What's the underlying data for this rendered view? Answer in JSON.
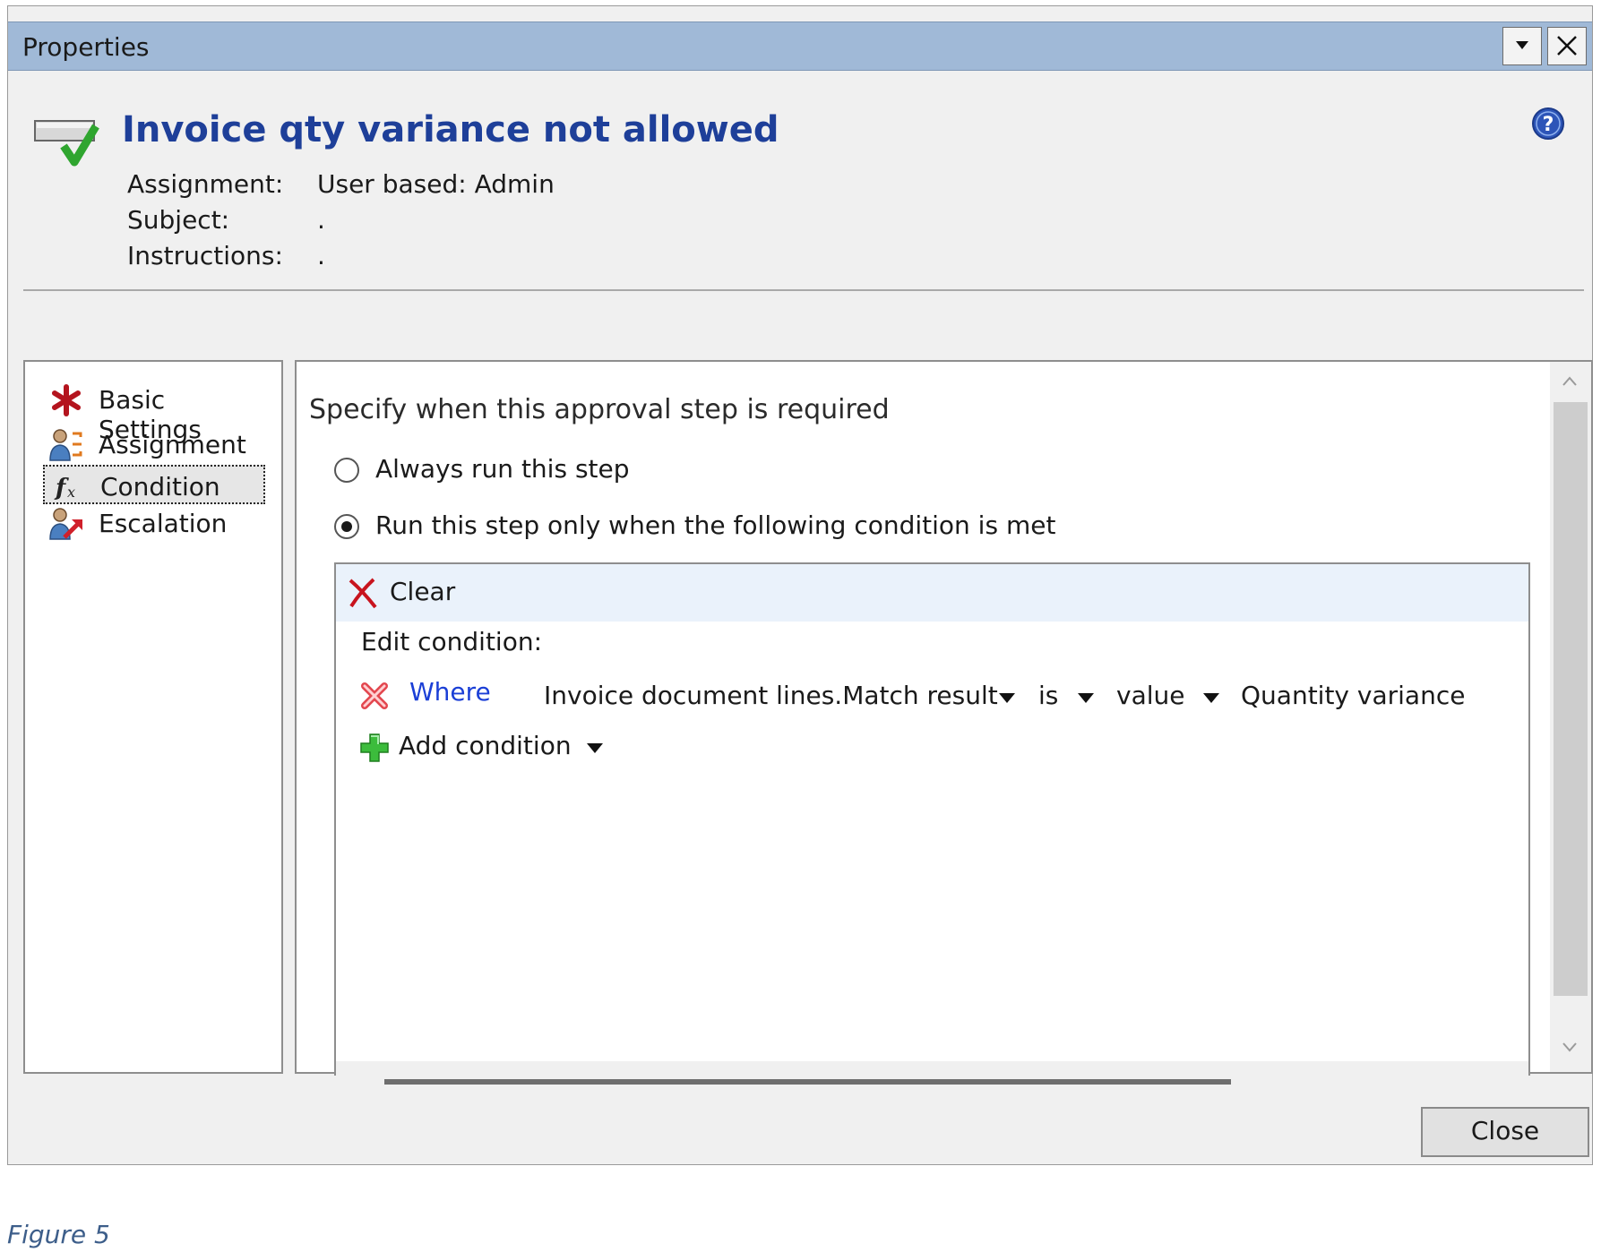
{
  "window": {
    "title": "Properties"
  },
  "header": {
    "title": "Invoice qty variance not allowed",
    "fields": [
      {
        "key": "Assignment:",
        "value": "User based: Admin"
      },
      {
        "key": "Subject:",
        "value": "."
      },
      {
        "key": "Instructions:",
        "value": "."
      }
    ]
  },
  "nav": {
    "items": [
      {
        "label": "Basic Settings",
        "icon": "red-asterisk-icon"
      },
      {
        "label": "Assignment",
        "icon": "users-assignment-icon"
      },
      {
        "label": "Condition",
        "icon": "fx-icon",
        "selected": true
      },
      {
        "label": "Escalation",
        "icon": "user-escalation-icon"
      }
    ]
  },
  "content": {
    "heading": "Specify when this approval step is required",
    "options": [
      {
        "label": "Always run this step",
        "checked": false
      },
      {
        "label": "Run this step only when the following condition is met",
        "checked": true
      }
    ],
    "condition": {
      "clear_label": "Clear",
      "edit_label": "Edit condition:",
      "where_label": "Where",
      "field": "Invoice document lines.Match result",
      "operator": "is",
      "value_type": "value",
      "value": "Quantity variance",
      "add_label": "Add condition"
    }
  },
  "footer": {
    "close_label": "Close"
  },
  "caption": "Figure 5",
  "colors": {
    "titlebar": "#a0b9d7",
    "header_title": "#1e3f99",
    "link": "#1b3fd6"
  }
}
